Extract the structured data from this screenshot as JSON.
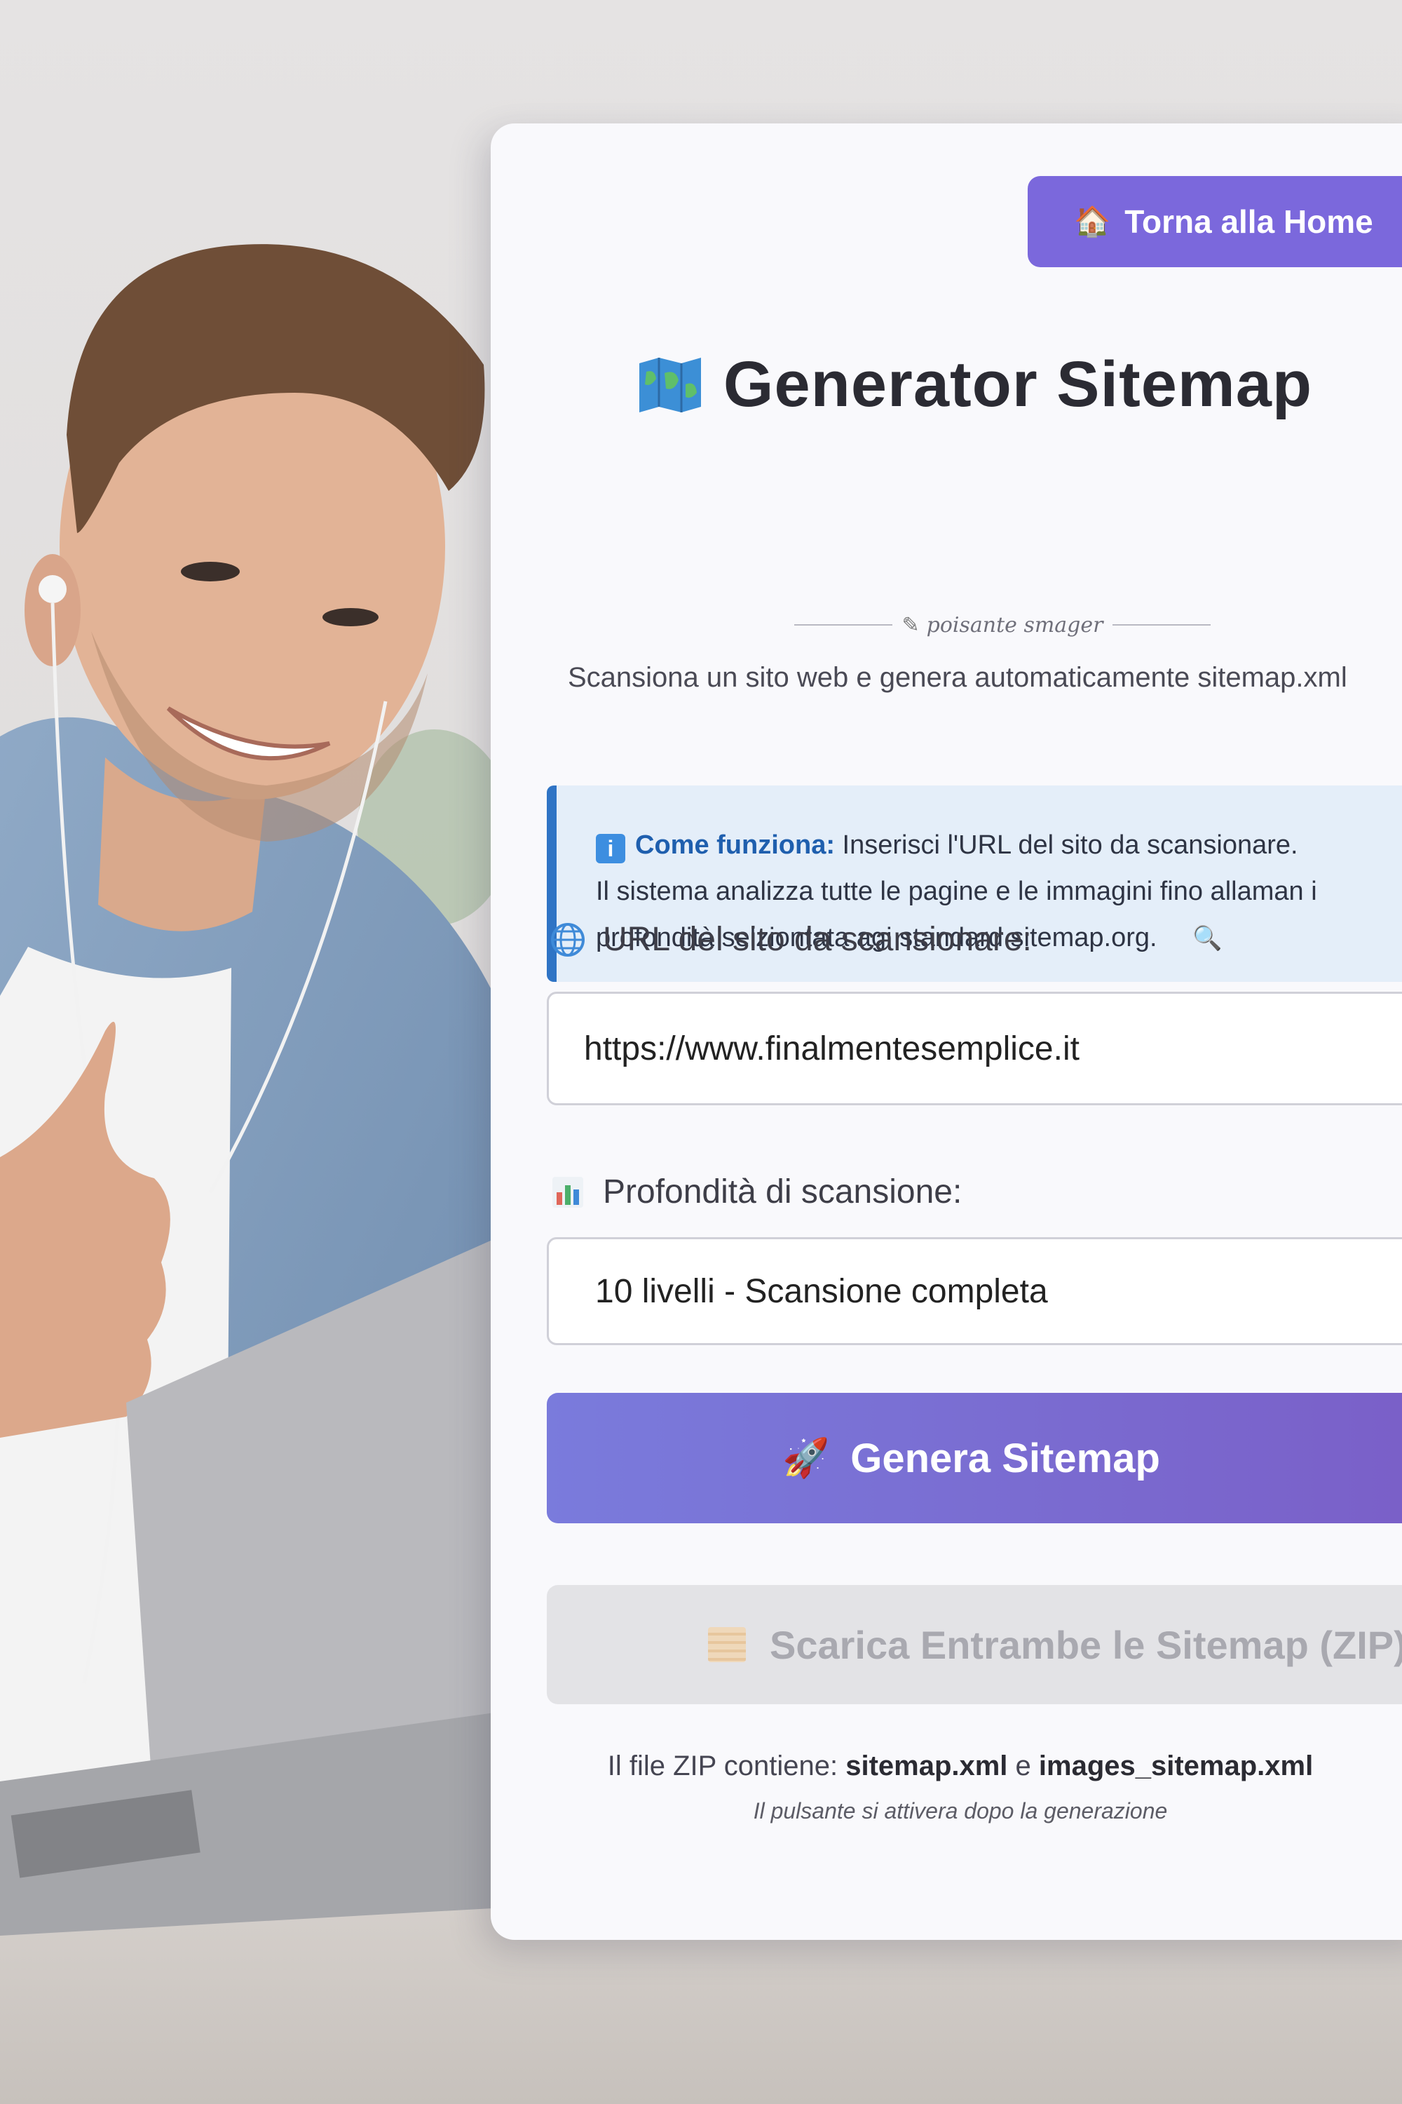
{
  "home_button": {
    "icon": "house-icon",
    "label": "Torna alla Home"
  },
  "header": {
    "title": "Generator Sitemap",
    "title_icon": "map-icon",
    "signature": "poisante smager",
    "subtitle": "Scansiona un sito web e genera automaticamente sitemap.xml"
  },
  "info_box": {
    "icon": "info-icon",
    "heading": "Come funziona:",
    "line1": "Inserisci l'URL del sito da scansionare.",
    "line2": "Il sistema analizza tutte le pagine e le immagini fino allaman i",
    "line3": "profondità selziontata agi standard sitemap.org.",
    "trailing_icon": "magnifier-icon"
  },
  "url_field": {
    "icon": "globe-icon",
    "label": "URL del sito da scansionare:",
    "value": "https://www.finalmentesemplice.it"
  },
  "depth_field": {
    "icon": "bar-chart-icon",
    "label": "Profondità di scansione:",
    "selected": "10 livelli - Scansione completa"
  },
  "generate_button": {
    "icon": "rocket-icon",
    "label": "Genera Sitemap"
  },
  "download_button": {
    "icon": "zip-archive-icon",
    "label": "Scarica Entrambe le Sitemap (ZIP)",
    "enabled": false
  },
  "zip_note": {
    "prefix": "Il file ZIP contiene: ",
    "file1": "sitemap.xml",
    "joiner": " e ",
    "file2": "images_sitemap.xml",
    "hint": "Il pulsante si attivera dopo la generazione"
  },
  "colors": {
    "accent": "#7b68dc",
    "info_border": "#2f74c5",
    "info_bg": "#e4eef9",
    "disabled_bg": "#e3e3e6"
  }
}
